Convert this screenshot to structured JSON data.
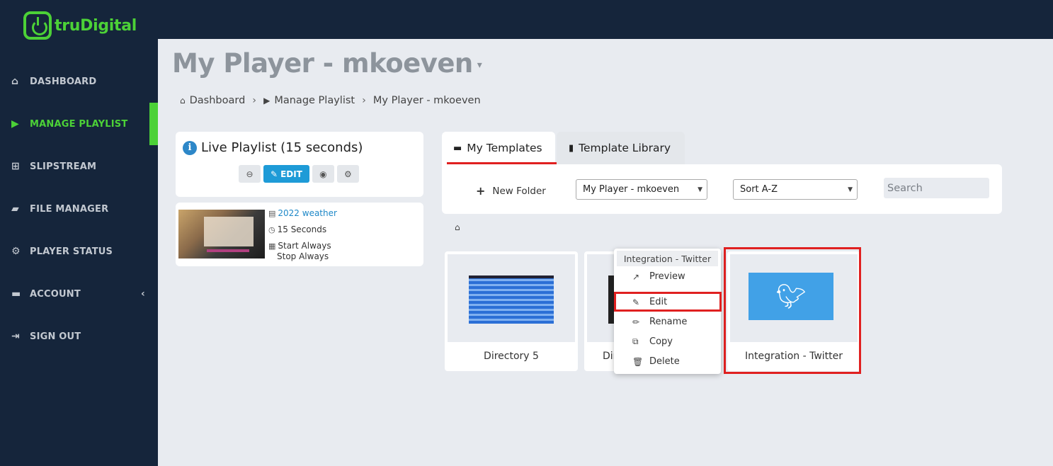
{
  "brand": {
    "name": "truDigital",
    "accent": "#4cd137"
  },
  "sidebar": {
    "items": [
      {
        "label": "DASHBOARD",
        "icon": "home-icon"
      },
      {
        "label": "MANAGE PLAYLIST",
        "icon": "youtube-play-icon",
        "active": true
      },
      {
        "label": "SLIPSTREAM",
        "icon": "sitemap-icon"
      },
      {
        "label": "FILE MANAGER",
        "icon": "folder-icon"
      },
      {
        "label": "PLAYER STATUS",
        "icon": "gears-icon"
      },
      {
        "label": "ACCOUNT",
        "icon": "briefcase-icon",
        "arrow": "‹"
      },
      {
        "label": "SIGN OUT",
        "icon": "sign-out-icon"
      }
    ]
  },
  "page": {
    "title": "My Player - mkoeven"
  },
  "breadcrumb": [
    "Dashboard",
    "Manage Playlist",
    "My Player - mkoeven"
  ],
  "live_playlist": {
    "title": "Live Playlist (15 seconds)",
    "edit_label": "EDIT",
    "item": {
      "name": "2022 weather",
      "duration": "15 Seconds",
      "start": "Start Always",
      "stop": "Stop Always"
    }
  },
  "tabs": {
    "my_templates": "My Templates",
    "template_library": "Template Library"
  },
  "toolbar": {
    "new_folder": "New Folder",
    "player_select": "My Player - mkoeven",
    "sort_select": "Sort A-Z",
    "search_placeholder": "Search"
  },
  "tiles": [
    {
      "name": "Directory 5"
    },
    {
      "name": "Dir"
    },
    {
      "name": "Integration - Twitter"
    }
  ],
  "context_menu": {
    "title": "Integration - Twitter",
    "items": [
      "Preview",
      "Edit",
      "Rename",
      "Copy",
      "Delete"
    ]
  }
}
